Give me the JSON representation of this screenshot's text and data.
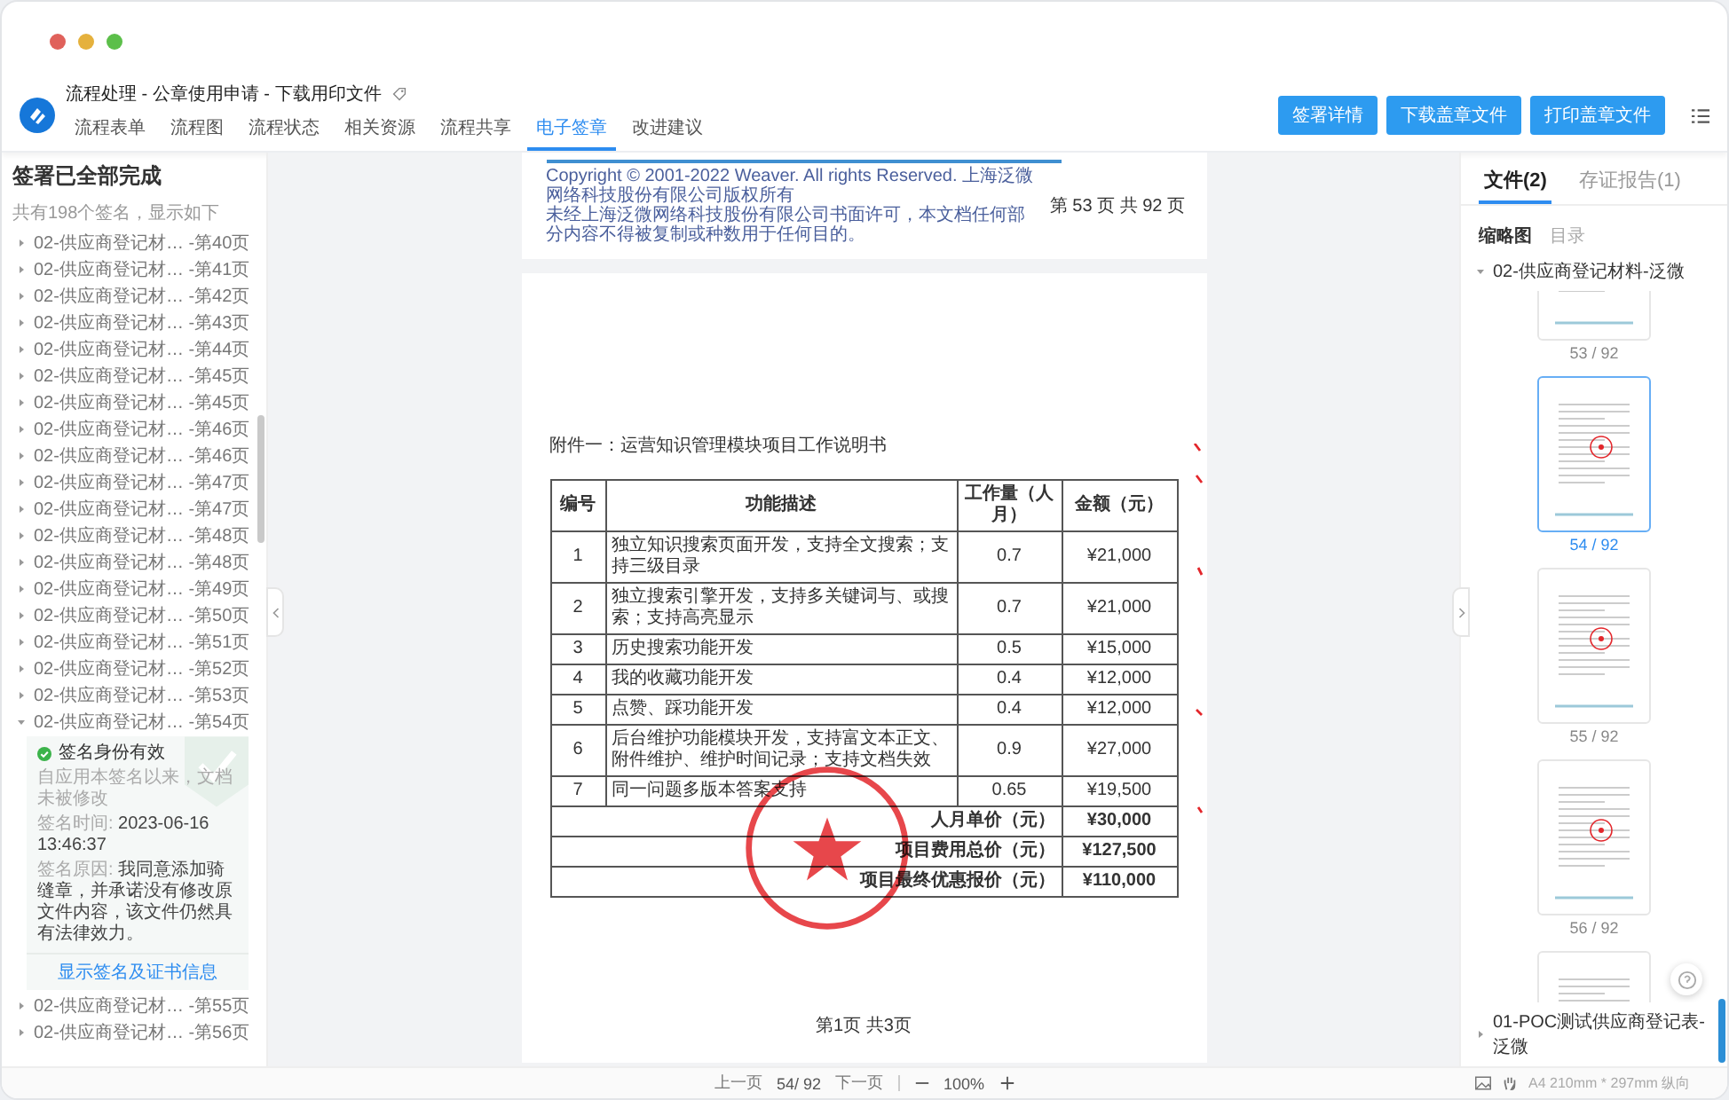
{
  "window": {
    "title": "流程处理 - 公章使用申请 - 下载用印文件"
  },
  "nav_tabs": [
    {
      "label": "流程表单",
      "selected": false
    },
    {
      "label": "流程图",
      "selected": false
    },
    {
      "label": "流程状态",
      "selected": false
    },
    {
      "label": "相关资源",
      "selected": false
    },
    {
      "label": "流程共享",
      "selected": false
    },
    {
      "label": "电子签章",
      "selected": true
    },
    {
      "label": "改进建议",
      "selected": false
    }
  ],
  "header_buttons": [
    "签署详情",
    "下载盖章文件",
    "打印盖章文件"
  ],
  "sidebar": {
    "title": "签署已全部完成",
    "summary": "共有198个签名，显示如下",
    "items": [
      {
        "label": "02-供应商登记材… -第40页",
        "expanded": false
      },
      {
        "label": "02-供应商登记材… -第41页",
        "expanded": false
      },
      {
        "label": "02-供应商登记材… -第42页",
        "expanded": false
      },
      {
        "label": "02-供应商登记材… -第43页",
        "expanded": false
      },
      {
        "label": "02-供应商登记材… -第44页",
        "expanded": false
      },
      {
        "label": "02-供应商登记材… -第45页",
        "expanded": false
      },
      {
        "label": "02-供应商登记材… -第45页",
        "expanded": false
      },
      {
        "label": "02-供应商登记材… -第46页",
        "expanded": false
      },
      {
        "label": "02-供应商登记材… -第46页",
        "expanded": false
      },
      {
        "label": "02-供应商登记材… -第47页",
        "expanded": false
      },
      {
        "label": "02-供应商登记材… -第47页",
        "expanded": false
      },
      {
        "label": "02-供应商登记材… -第48页",
        "expanded": false
      },
      {
        "label": "02-供应商登记材… -第48页",
        "expanded": false
      },
      {
        "label": "02-供应商登记材… -第49页",
        "expanded": false
      },
      {
        "label": "02-供应商登记材… -第50页",
        "expanded": false
      },
      {
        "label": "02-供应商登记材… -第51页",
        "expanded": false
      },
      {
        "label": "02-供应商登记材… -第52页",
        "expanded": false
      },
      {
        "label": "02-供应商登记材… -第53页",
        "expanded": false
      },
      {
        "label": "02-供应商登记材… -第54页",
        "expanded": true,
        "detail": {
          "status": "签名身份有效",
          "status_note": "自应用本签名以来，文档未被修改",
          "time_label": "签名时间:",
          "time": "2023-06-16 13:46:37",
          "reason_label": "签名原因:",
          "reason": "我同意添加骑缝章，并承诺没有修改原文件内容，该文件仍然具有法律效力。",
          "link": "显示签名及证书信息"
        }
      },
      {
        "label": "02-供应商登记材… -第55页",
        "expanded": false
      },
      {
        "label": "02-供应商登记材… -第56页",
        "expanded": false
      }
    ]
  },
  "document": {
    "prev_page": {
      "copyright": "Copyright © 2001-2022 Weaver. All rights Reserved. 上海泛微网络科技股份有限公司版权所有",
      "notice": "未经上海泛微网络科技股份有限公司书面许可，本文档任何部分内容不得被复制或种数用于任何目的。",
      "page": "第 53 页 共 92 页"
    },
    "heading": "附件一：运营知识管理模块项目工作说明书",
    "columns": [
      "编号",
      "功能描述",
      "工作量（人月）",
      "金额（元）"
    ],
    "rows": [
      [
        "1",
        "独立知识搜索页面开发，支持全文搜索；支持三级目录",
        "0.7",
        "¥21,000"
      ],
      [
        "2",
        "独立搜索引擎开发，支持多关键词与、或搜索；支持高亮显示",
        "0.7",
        "¥21,000"
      ],
      [
        "3",
        "历史搜索功能开发",
        "0.5",
        "¥15,000"
      ],
      [
        "4",
        "我的收藏功能开发",
        "0.4",
        "¥12,000"
      ],
      [
        "5",
        "点赞、踩功能开发",
        "0.4",
        "¥12,000"
      ],
      [
        "6",
        "后台维护功能模块开发，支持富文本正文、附件维护、维护时间记录；支持文档失效",
        "0.9",
        "¥27,000"
      ],
      [
        "7",
        "同一问题多版本答案支持",
        "0.65",
        "¥19,500"
      ]
    ],
    "totals": [
      {
        "label": "人月单价（元）",
        "value": "¥30,000"
      },
      {
        "label": "项目费用总价（元）",
        "value": "¥127,500"
      },
      {
        "label": "项目最终优惠报价（元）",
        "value": "¥110,000"
      }
    ],
    "page_footer": "第1页 共3页"
  },
  "right_panel": {
    "tabs": [
      {
        "label": "文件(2)",
        "selected": true
      },
      {
        "label": "存证报告(1)",
        "selected": false
      }
    ],
    "view_tabs": [
      {
        "label": "缩略图",
        "selected": true
      },
      {
        "label": "目录",
        "selected": false
      }
    ],
    "files": [
      {
        "name": "02-供应商登记材料-泛微",
        "expanded": true,
        "thumbnails": [
          {
            "label": "53 / 92",
            "selected": false
          },
          {
            "label": "54 / 92",
            "selected": true
          },
          {
            "label": "55 / 92",
            "selected": false
          },
          {
            "label": "56 / 92",
            "selected": false
          },
          {
            "selected": false
          }
        ]
      },
      {
        "name": "01-POC测试供应商登记表-泛微",
        "expanded": false
      }
    ],
    "paper": "A4 210mm * 297mm 纵向"
  },
  "bottom_bar": {
    "prev": "上一页",
    "page": "54/ 92",
    "next": "下一页",
    "zoom": "100%"
  }
}
